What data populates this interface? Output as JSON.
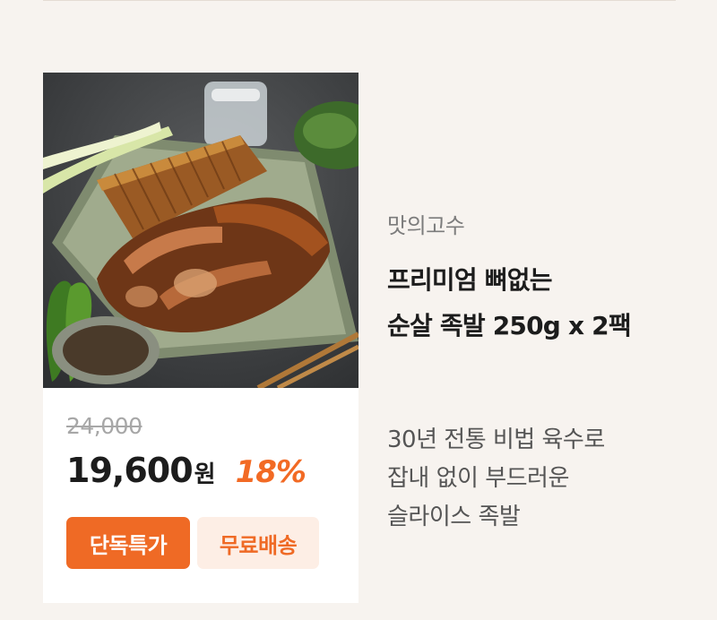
{
  "product": {
    "brand": "맛의고수",
    "title_line1": "프리미엄 뼈없는",
    "title_line2": "순살 족발 250g x 2팩",
    "description_line1": "30년 전통 비법 육수로",
    "description_line2": "잡내 없이 부드러운",
    "description_line3": "슬라이스 족발",
    "original_price": "24,000",
    "sale_price": "19,600",
    "currency": "원",
    "discount": "18%"
  },
  "badges": {
    "exclusive": "단독특가",
    "free_shipping": "무료배송"
  },
  "colors": {
    "accent": "#ef6a25",
    "accent_light": "#fdeee5",
    "background": "#f7f3ef"
  }
}
